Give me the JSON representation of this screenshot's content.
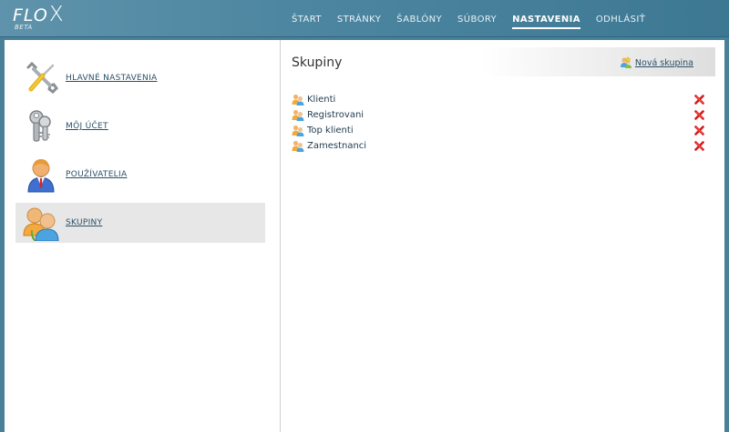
{
  "app": {
    "logo": "FLO",
    "logo_x": "X",
    "logo_sub": "BETA"
  },
  "nav": {
    "items": [
      {
        "label": "ŠTART",
        "active": false
      },
      {
        "label": "STRÁNKY",
        "active": false
      },
      {
        "label": "ŠABLÓNY",
        "active": false
      },
      {
        "label": "SÚBORY",
        "active": false
      },
      {
        "label": "NASTAVENIA",
        "active": true
      },
      {
        "label": "ODHLÁSIŤ",
        "active": false
      }
    ]
  },
  "sidebar": {
    "items": [
      {
        "label": "HLAVNÉ NASTAVENIA",
        "icon": "tools-icon",
        "active": false
      },
      {
        "label": "MÔJ ÚČET",
        "icon": "keys-icon",
        "active": false
      },
      {
        "label": "POUŽÍVATELIA",
        "icon": "user-icon",
        "active": false
      },
      {
        "label": "SKUPINY",
        "icon": "users-group-icon",
        "active": true
      }
    ]
  },
  "main": {
    "title": "Skupiny",
    "new_group_label": "Nová skupina",
    "groups": [
      {
        "name": "Klienti"
      },
      {
        "name": "Registrovani"
      },
      {
        "name": "Top klienti"
      },
      {
        "name": "Zamestnanci"
      }
    ]
  },
  "colors": {
    "accent": "#4b8099",
    "link": "#2a4f68",
    "delete": "#cc1111"
  }
}
